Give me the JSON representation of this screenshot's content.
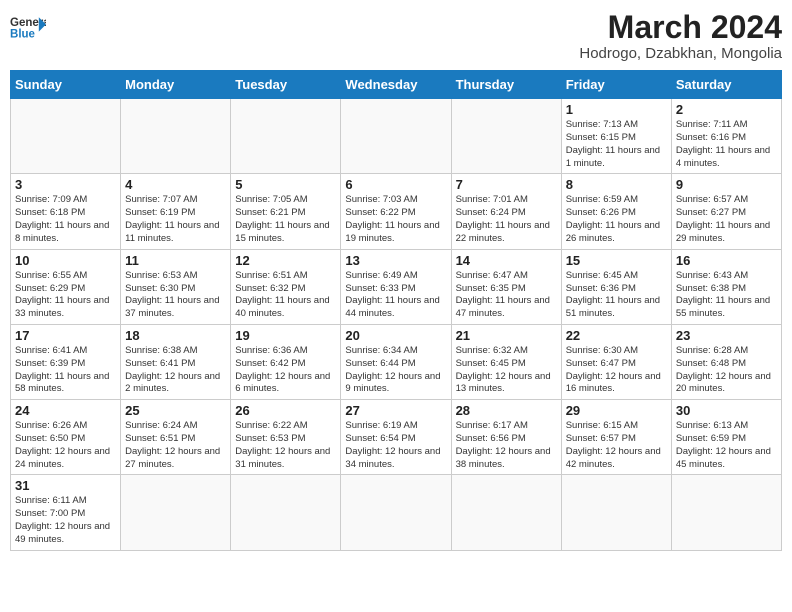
{
  "logo": {
    "text_general": "General",
    "text_blue": "Blue"
  },
  "title": "March 2024",
  "subtitle": "Hodrogo, Dzabkhan, Mongolia",
  "days_of_week": [
    "Sunday",
    "Monday",
    "Tuesday",
    "Wednesday",
    "Thursday",
    "Friday",
    "Saturday"
  ],
  "weeks": [
    [
      {
        "day": "",
        "info": ""
      },
      {
        "day": "",
        "info": ""
      },
      {
        "day": "",
        "info": ""
      },
      {
        "day": "",
        "info": ""
      },
      {
        "day": "",
        "info": ""
      },
      {
        "day": "1",
        "info": "Sunrise: 7:13 AM\nSunset: 6:15 PM\nDaylight: 11 hours and 1 minute."
      },
      {
        "day": "2",
        "info": "Sunrise: 7:11 AM\nSunset: 6:16 PM\nDaylight: 11 hours and 4 minutes."
      }
    ],
    [
      {
        "day": "3",
        "info": "Sunrise: 7:09 AM\nSunset: 6:18 PM\nDaylight: 11 hours and 8 minutes."
      },
      {
        "day": "4",
        "info": "Sunrise: 7:07 AM\nSunset: 6:19 PM\nDaylight: 11 hours and 11 minutes."
      },
      {
        "day": "5",
        "info": "Sunrise: 7:05 AM\nSunset: 6:21 PM\nDaylight: 11 hours and 15 minutes."
      },
      {
        "day": "6",
        "info": "Sunrise: 7:03 AM\nSunset: 6:22 PM\nDaylight: 11 hours and 19 minutes."
      },
      {
        "day": "7",
        "info": "Sunrise: 7:01 AM\nSunset: 6:24 PM\nDaylight: 11 hours and 22 minutes."
      },
      {
        "day": "8",
        "info": "Sunrise: 6:59 AM\nSunset: 6:26 PM\nDaylight: 11 hours and 26 minutes."
      },
      {
        "day": "9",
        "info": "Sunrise: 6:57 AM\nSunset: 6:27 PM\nDaylight: 11 hours and 29 minutes."
      }
    ],
    [
      {
        "day": "10",
        "info": "Sunrise: 6:55 AM\nSunset: 6:29 PM\nDaylight: 11 hours and 33 minutes."
      },
      {
        "day": "11",
        "info": "Sunrise: 6:53 AM\nSunset: 6:30 PM\nDaylight: 11 hours and 37 minutes."
      },
      {
        "day": "12",
        "info": "Sunrise: 6:51 AM\nSunset: 6:32 PM\nDaylight: 11 hours and 40 minutes."
      },
      {
        "day": "13",
        "info": "Sunrise: 6:49 AM\nSunset: 6:33 PM\nDaylight: 11 hours and 44 minutes."
      },
      {
        "day": "14",
        "info": "Sunrise: 6:47 AM\nSunset: 6:35 PM\nDaylight: 11 hours and 47 minutes."
      },
      {
        "day": "15",
        "info": "Sunrise: 6:45 AM\nSunset: 6:36 PM\nDaylight: 11 hours and 51 minutes."
      },
      {
        "day": "16",
        "info": "Sunrise: 6:43 AM\nSunset: 6:38 PM\nDaylight: 11 hours and 55 minutes."
      }
    ],
    [
      {
        "day": "17",
        "info": "Sunrise: 6:41 AM\nSunset: 6:39 PM\nDaylight: 11 hours and 58 minutes."
      },
      {
        "day": "18",
        "info": "Sunrise: 6:38 AM\nSunset: 6:41 PM\nDaylight: 12 hours and 2 minutes."
      },
      {
        "day": "19",
        "info": "Sunrise: 6:36 AM\nSunset: 6:42 PM\nDaylight: 12 hours and 6 minutes."
      },
      {
        "day": "20",
        "info": "Sunrise: 6:34 AM\nSunset: 6:44 PM\nDaylight: 12 hours and 9 minutes."
      },
      {
        "day": "21",
        "info": "Sunrise: 6:32 AM\nSunset: 6:45 PM\nDaylight: 12 hours and 13 minutes."
      },
      {
        "day": "22",
        "info": "Sunrise: 6:30 AM\nSunset: 6:47 PM\nDaylight: 12 hours and 16 minutes."
      },
      {
        "day": "23",
        "info": "Sunrise: 6:28 AM\nSunset: 6:48 PM\nDaylight: 12 hours and 20 minutes."
      }
    ],
    [
      {
        "day": "24",
        "info": "Sunrise: 6:26 AM\nSunset: 6:50 PM\nDaylight: 12 hours and 24 minutes."
      },
      {
        "day": "25",
        "info": "Sunrise: 6:24 AM\nSunset: 6:51 PM\nDaylight: 12 hours and 27 minutes."
      },
      {
        "day": "26",
        "info": "Sunrise: 6:22 AM\nSunset: 6:53 PM\nDaylight: 12 hours and 31 minutes."
      },
      {
        "day": "27",
        "info": "Sunrise: 6:19 AM\nSunset: 6:54 PM\nDaylight: 12 hours and 34 minutes."
      },
      {
        "day": "28",
        "info": "Sunrise: 6:17 AM\nSunset: 6:56 PM\nDaylight: 12 hours and 38 minutes."
      },
      {
        "day": "29",
        "info": "Sunrise: 6:15 AM\nSunset: 6:57 PM\nDaylight: 12 hours and 42 minutes."
      },
      {
        "day": "30",
        "info": "Sunrise: 6:13 AM\nSunset: 6:59 PM\nDaylight: 12 hours and 45 minutes."
      }
    ],
    [
      {
        "day": "31",
        "info": "Sunrise: 6:11 AM\nSunset: 7:00 PM\nDaylight: 12 hours and 49 minutes."
      },
      {
        "day": "",
        "info": ""
      },
      {
        "day": "",
        "info": ""
      },
      {
        "day": "",
        "info": ""
      },
      {
        "day": "",
        "info": ""
      },
      {
        "day": "",
        "info": ""
      },
      {
        "day": "",
        "info": ""
      }
    ]
  ]
}
